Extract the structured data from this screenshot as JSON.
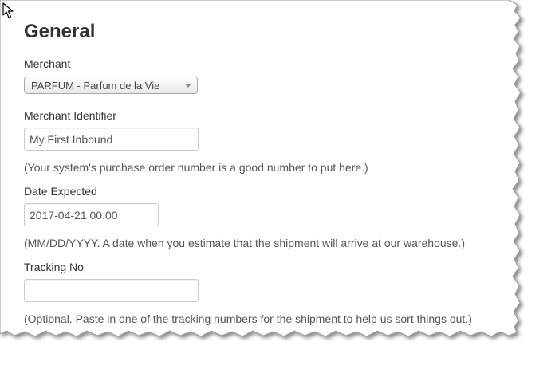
{
  "form": {
    "title": "General",
    "merchant": {
      "label": "Merchant",
      "selected": "PARFUM - Parfum de la Vie"
    },
    "merchant_identifier": {
      "label": "Merchant Identifier",
      "value": "My First Inbound",
      "help": "(Your system's purchase order number is a good number to put here.)"
    },
    "date_expected": {
      "label": "Date Expected",
      "value": "2017-04-21 00:00",
      "help": "(MM/DD/YYYY. A date when you estimate that the shipment will arrive at our warehouse.)"
    },
    "tracking_no": {
      "label": "Tracking No",
      "value": "",
      "help": "(Optional. Paste in one of the tracking numbers for the shipment to help us sort things out.)"
    }
  },
  "icons": {
    "cursor": "mouse-pointer-icon",
    "select_arrow": "caret-down-icon"
  },
  "colors": {
    "text": "#333333",
    "help_text": "#555555",
    "input_border": "#cccccc"
  }
}
